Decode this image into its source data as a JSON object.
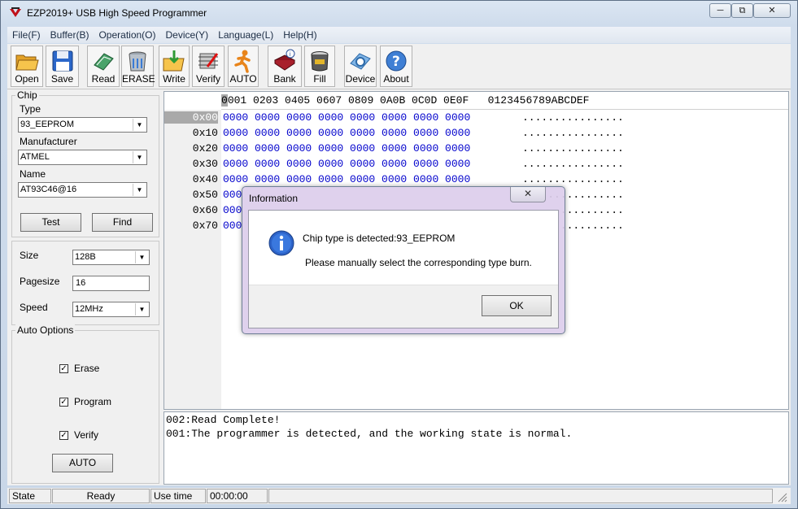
{
  "window": {
    "title": "EZP2019+ USB High Speed Programmer"
  },
  "menu": [
    "File(F)",
    "Buffer(B)",
    "Operation(O)",
    "Device(Y)",
    "Language(L)",
    "Help(H)"
  ],
  "toolbar": {
    "open": "Open",
    "save": "Save",
    "read": "Read",
    "erase": "ERASE",
    "write": "Write",
    "verify": "Verify",
    "auto": "AUTO",
    "bank": "Bank",
    "fill": "Fill",
    "device": "Device",
    "about": "About"
  },
  "chip": {
    "group_label": "Chip",
    "type_label": "Type",
    "type_value": "93_EEPROM",
    "manufacturer_label": "Manufacturer",
    "manufacturer_value": "ATMEL",
    "name_label": "Name",
    "name_value": "AT93C46@16",
    "test_button": "Test",
    "find_button": "Find"
  },
  "settings": {
    "size_label": "Size",
    "size_value": "128B",
    "pagesize_label": "Pagesize",
    "pagesize_value": "16",
    "speed_label": "Speed",
    "speed_value": "12MHz"
  },
  "auto_options": {
    "group_label": "Auto Options",
    "erase": "Erase",
    "program": "Program",
    "verify": "Verify",
    "auto_button": "AUTO"
  },
  "hex": {
    "cursor_char": "0",
    "header": "001 0203 0405 0607 0809 0A0B 0C0D 0E0F   0123456789ABCDEF",
    "rows": [
      {
        "addr": "0x00",
        "bytes": "0000 0000 0000 0000 0000 0000 0000 0000",
        "ascii": "................"
      },
      {
        "addr": "0x10",
        "bytes": "0000 0000 0000 0000 0000 0000 0000 0000",
        "ascii": "................"
      },
      {
        "addr": "0x20",
        "bytes": "0000 0000 0000 0000 0000 0000 0000 0000",
        "ascii": "................"
      },
      {
        "addr": "0x30",
        "bytes": "0000 0000 0000 0000 0000 0000 0000 0000",
        "ascii": "................"
      },
      {
        "addr": "0x40",
        "bytes": "0000 0000 0000 0000 0000 0000 0000 0000",
        "ascii": "................"
      },
      {
        "addr": "0x50",
        "bytes": "000",
        "ascii": "................"
      },
      {
        "addr": "0x60",
        "bytes": "000",
        "ascii": "................"
      },
      {
        "addr": "0x70",
        "bytes": "000",
        "ascii": "................"
      }
    ]
  },
  "log": [
    "002:Read Complete!",
    "001:The programmer is detected, and the working state is normal."
  ],
  "status": {
    "state_label": "State",
    "state_value": "Ready",
    "time_label": "Use time",
    "time_value": "00:00:00"
  },
  "dialog": {
    "title": "Information",
    "message": "Chip type is detected:93_EEPROM",
    "detail": "Please manually select the corresponding type burn.",
    "ok": "OK"
  }
}
